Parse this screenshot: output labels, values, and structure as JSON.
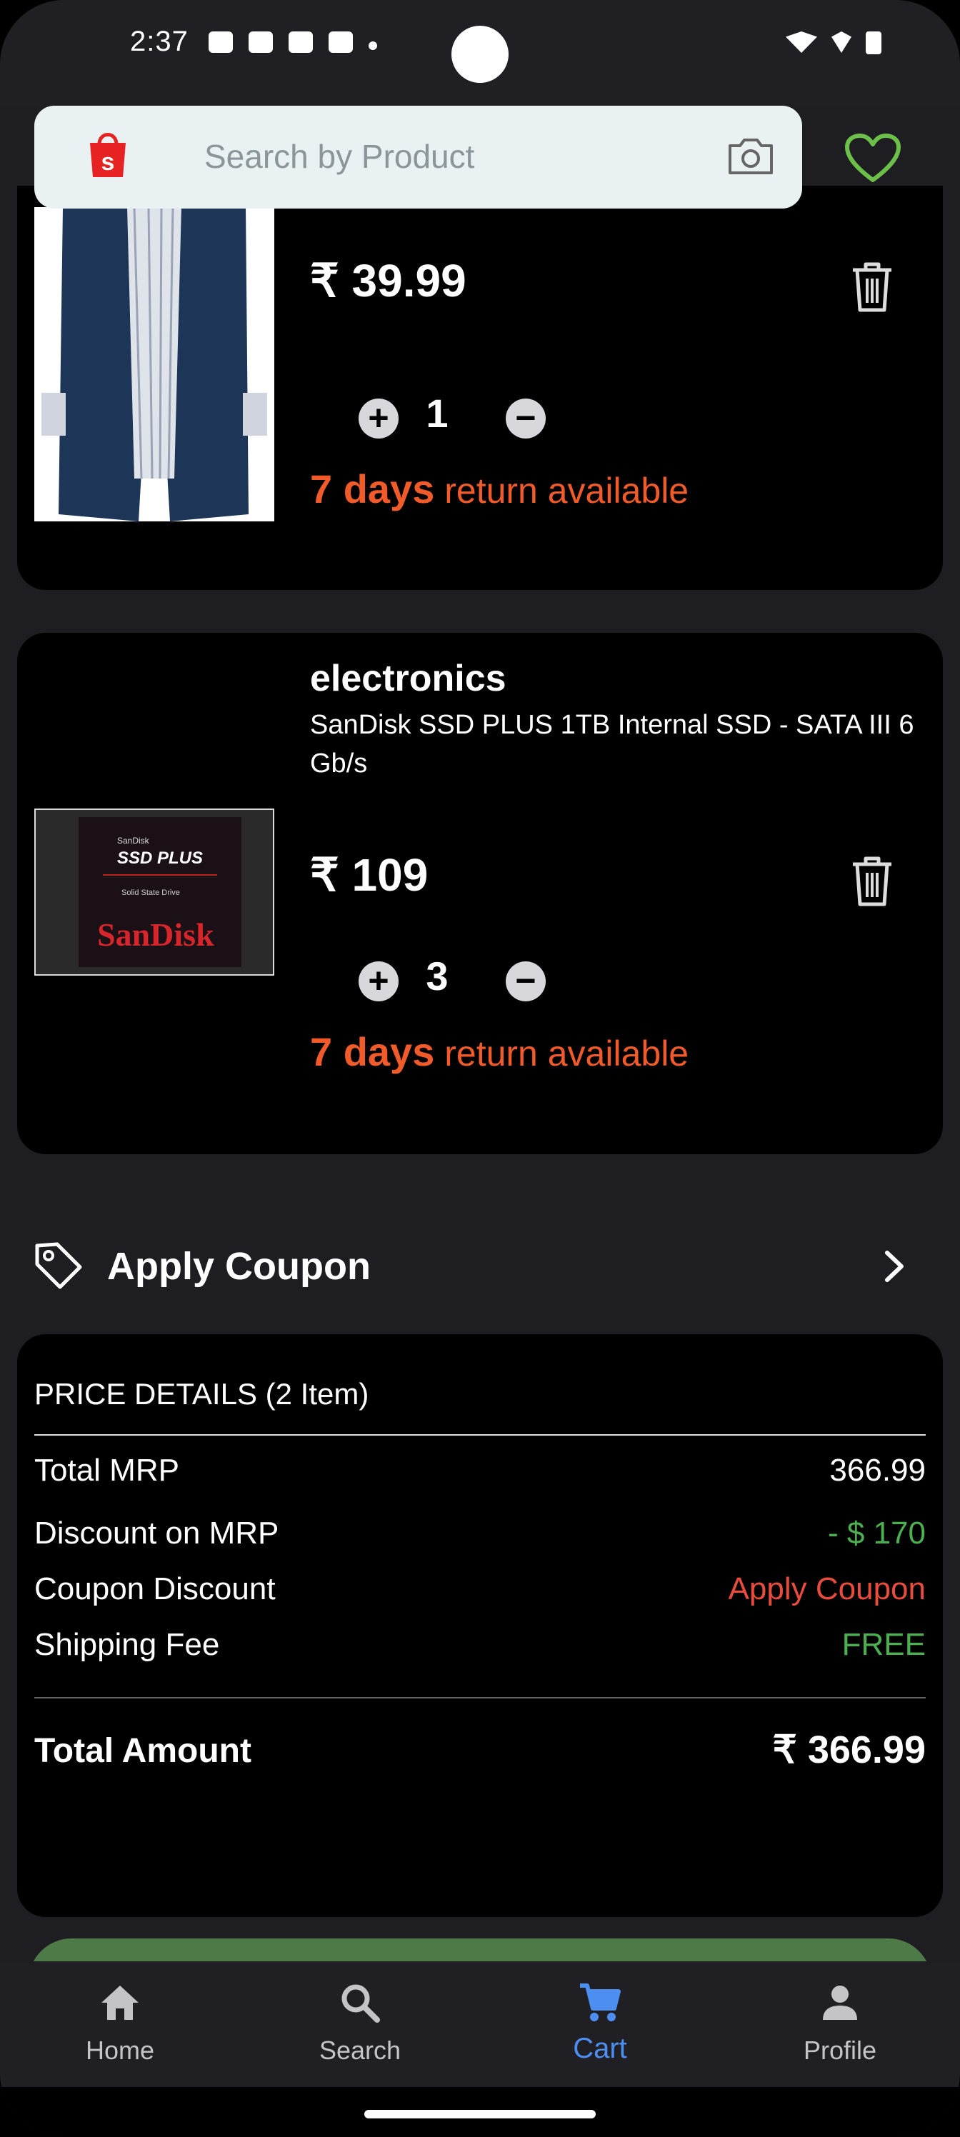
{
  "status_bar": {
    "time": "2:37"
  },
  "search": {
    "placeholder": "Search by Product"
  },
  "cart": {
    "items": [
      {
        "price": "₹ 39.99",
        "quantity": "1",
        "return_days": "7 days",
        "return_text": " return available"
      },
      {
        "category": "electronics",
        "title": "SanDisk SSD PLUS 1TB Internal SSD - SATA III 6 Gb/s",
        "price": "₹ 109",
        "quantity": "3",
        "return_days": "7 days",
        "return_text": " return available",
        "image_text": {
          "small": "SanDisk",
          "line1": "SSD PLUS",
          "line2": "Solid State Drive",
          "brand": "SanDisk"
        }
      }
    ]
  },
  "coupon": {
    "label": "Apply Coupon"
  },
  "price_details": {
    "heading": "PRICE DETAILS (2 Item)",
    "rows": [
      {
        "label": "Total MRP",
        "value": "366.99"
      },
      {
        "label": "Discount on MRP",
        "value": "- $ 170"
      },
      {
        "label": "Coupon Discount",
        "value": "Apply Coupon"
      },
      {
        "label": "Shipping Fee",
        "value": "FREE"
      }
    ],
    "total_label": "Total Amount",
    "total_value": "₹ 366.99"
  },
  "bottom_nav": [
    {
      "label": "Home",
      "icon": "home-icon"
    },
    {
      "label": "Search",
      "icon": "search-icon"
    },
    {
      "label": "Cart",
      "icon": "cart-icon",
      "active": true
    },
    {
      "label": "Profile",
      "icon": "profile-icon"
    }
  ],
  "colors": {
    "accent": "#f15a29",
    "green": "#4caf50",
    "red": "#e94b3c",
    "nav_active": "#4d8ff0"
  }
}
